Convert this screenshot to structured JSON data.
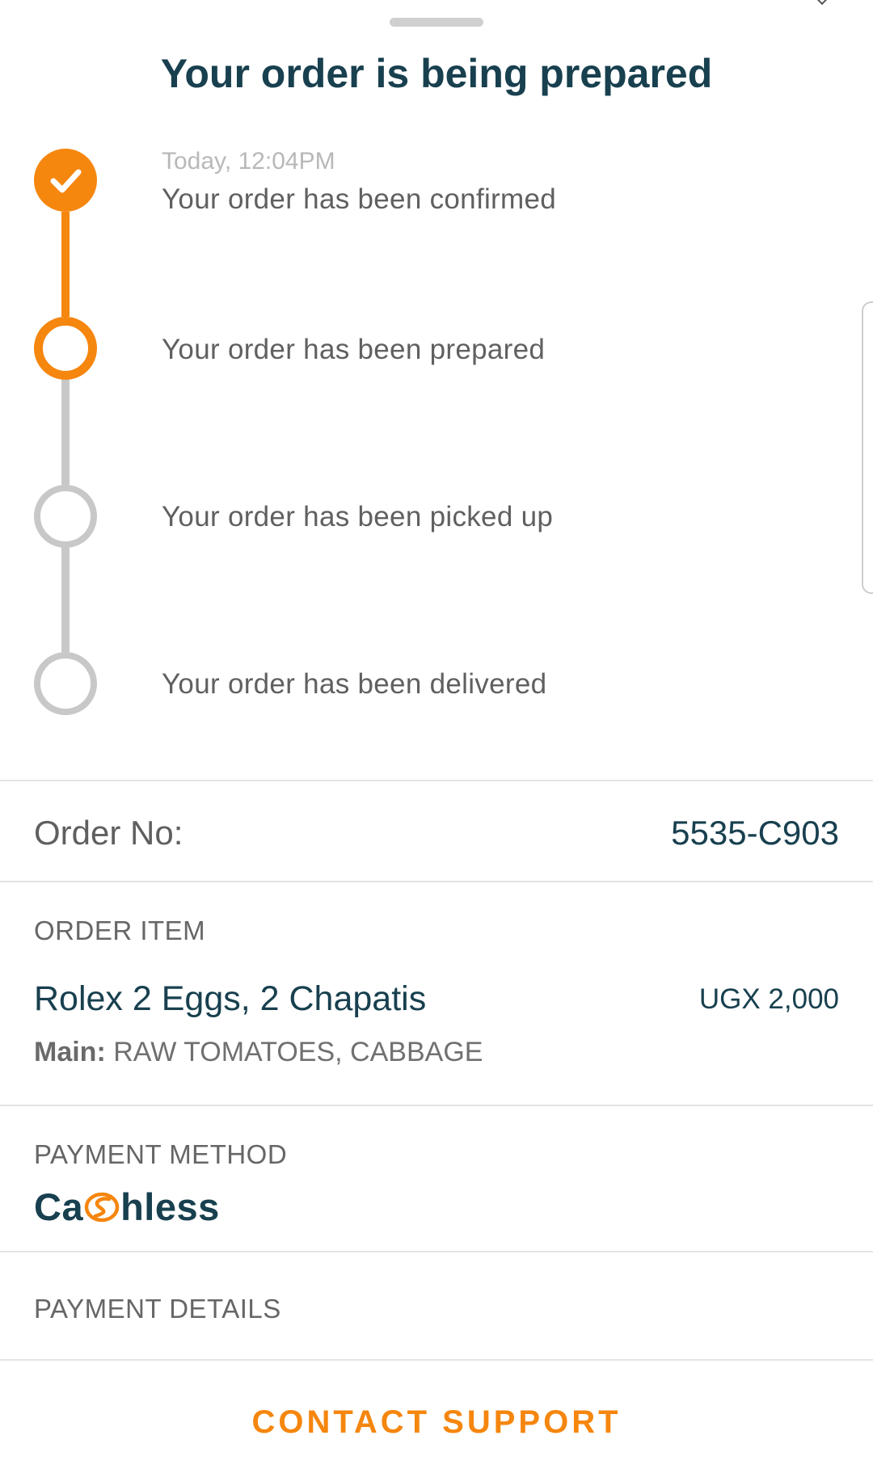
{
  "header": {
    "title": "Your order is being prepared"
  },
  "timeline": {
    "steps": [
      {
        "time": "Today, 12:04PM",
        "label": "Your order has been confirmed",
        "status": "done"
      },
      {
        "time": "",
        "label": "Your order has been prepared",
        "status": "current"
      },
      {
        "time": "",
        "label": "Your order has been picked up",
        "status": "pending"
      },
      {
        "time": "",
        "label": "Your order has been delivered",
        "status": "pending"
      }
    ]
  },
  "order": {
    "number_label": "Order No:",
    "number_value": "5535-C903"
  },
  "order_item": {
    "heading": "ORDER ITEM",
    "name": "Rolex 2 Eggs, 2 Chapatis",
    "price": "UGX 2,000",
    "options_label": "Main:",
    "options_value": "RAW TOMATOES, CABBAGE"
  },
  "payment_method": {
    "heading": "PAYMENT METHOD",
    "logo_text_before": "Ca",
    "logo_text_after": "hless"
  },
  "payment_details": {
    "heading": "PAYMENT DETAILS"
  },
  "actions": {
    "contact_support": "CONTACT SUPPORT"
  },
  "colors": {
    "accent": "#f5860e",
    "primary_text": "#18404f",
    "inactive": "#c8c8c8"
  },
  "icons": {
    "done_step": "checkmark-icon",
    "logo_s": "cashless-s-logo-icon"
  }
}
